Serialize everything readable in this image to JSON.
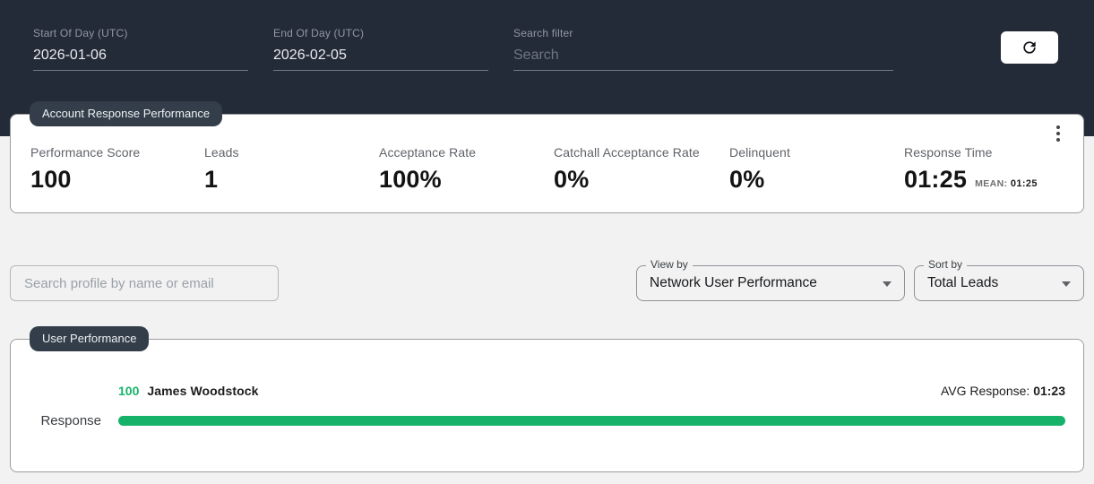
{
  "colors": {
    "header_bg": "#242b38",
    "chip_bg": "#333e4a",
    "page_bg": "#f2f2f3",
    "accent_green": "#17b26a",
    "card_border": "#9e9e9e"
  },
  "header": {
    "start_of_day": {
      "label": "Start Of Day (UTC)",
      "value": "2026-01-06"
    },
    "end_of_day": {
      "label": "End Of Day (UTC)",
      "value": "2026-02-05"
    },
    "search_filter": {
      "label": "Search filter",
      "placeholder": "Search",
      "value": ""
    }
  },
  "account_card": {
    "title": "Account Response Performance",
    "metrics": [
      {
        "label": "Performance Score",
        "value": "100"
      },
      {
        "label": "Leads",
        "value": "1"
      },
      {
        "label": "Acceptance Rate",
        "value": "100%"
      },
      {
        "label": "Catchall Acceptance Rate",
        "value": "0%"
      },
      {
        "label": "Delinquent",
        "value": "0%"
      },
      {
        "label": "Response Time",
        "value": "01:25",
        "sub_label": "MEAN:",
        "sub_value": "01:25"
      }
    ]
  },
  "filters": {
    "profile_search_placeholder": "Search profile by name or email",
    "view_by": {
      "label": "View by",
      "value": "Network User Performance"
    },
    "sort_by": {
      "label": "Sort by",
      "value": "Total Leads"
    }
  },
  "user_card": {
    "title": "User Performance",
    "rows": [
      {
        "score": "100",
        "name": "James Woodstock",
        "avg_label": "AVG Response: ",
        "avg_value": "01:23",
        "metric_label": "Response",
        "bar_width": "100%"
      }
    ]
  }
}
